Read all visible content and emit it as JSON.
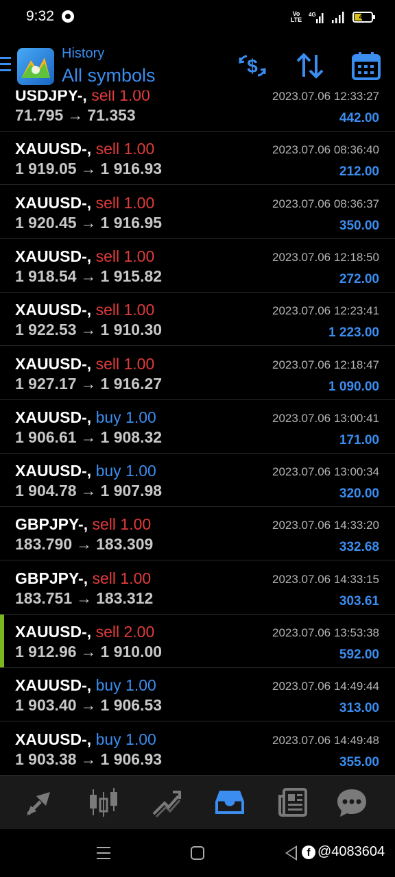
{
  "status_bar": {
    "time": "9:32",
    "network": "4G",
    "volte_line1": "Vo",
    "volte_line2": "LTE",
    "battery": "43"
  },
  "header": {
    "subtitle": "History",
    "title": "All symbols"
  },
  "trades": [
    {
      "symbol": "USDJPY-,",
      "side": "sell",
      "volume": "1.00",
      "open": "71.795",
      "close": "71.353",
      "time": "2023.07.06 12:33:27",
      "profit": "442.00"
    },
    {
      "symbol": "XAUUSD-,",
      "side": "sell",
      "volume": "1.00",
      "open": "1 919.05",
      "close": "1 916.93",
      "time": "2023.07.06 08:36:40",
      "profit": "212.00"
    },
    {
      "symbol": "XAUUSD-,",
      "side": "sell",
      "volume": "1.00",
      "open": "1 920.45",
      "close": "1 916.95",
      "time": "2023.07.06 08:36:37",
      "profit": "350.00"
    },
    {
      "symbol": "XAUUSD-,",
      "side": "sell",
      "volume": "1.00",
      "open": "1 918.54",
      "close": "1 915.82",
      "time": "2023.07.06 12:18:50",
      "profit": "272.00"
    },
    {
      "symbol": "XAUUSD-,",
      "side": "sell",
      "volume": "1.00",
      "open": "1 922.53",
      "close": "1 910.30",
      "time": "2023.07.06 12:23:41",
      "profit": "1 223.00"
    },
    {
      "symbol": "XAUUSD-,",
      "side": "sell",
      "volume": "1.00",
      "open": "1 927.17",
      "close": "1 916.27",
      "time": "2023.07.06 12:18:47",
      "profit": "1 090.00"
    },
    {
      "symbol": "XAUUSD-,",
      "side": "buy",
      "volume": "1.00",
      "open": "1 906.61",
      "close": "1 908.32",
      "time": "2023.07.06 13:00:41",
      "profit": "171.00"
    },
    {
      "symbol": "XAUUSD-,",
      "side": "buy",
      "volume": "1.00",
      "open": "1 904.78",
      "close": "1 907.98",
      "time": "2023.07.06 13:00:34",
      "profit": "320.00"
    },
    {
      "symbol": "GBPJPY-,",
      "side": "sell",
      "volume": "1.00",
      "open": "183.790",
      "close": "183.309",
      "time": "2023.07.06 14:33:20",
      "profit": "332.68"
    },
    {
      "symbol": "GBPJPY-,",
      "side": "sell",
      "volume": "1.00",
      "open": "183.751",
      "close": "183.312",
      "time": "2023.07.06 14:33:15",
      "profit": "303.61"
    },
    {
      "symbol": "XAUUSD-,",
      "side": "sell",
      "volume": "2.00",
      "open": "1 912.96",
      "close": "1 910.00",
      "time": "2023.07.06 13:53:38",
      "profit": "592.00",
      "highlighted": true
    },
    {
      "symbol": "XAUUSD-,",
      "side": "buy",
      "volume": "1.00",
      "open": "1 903.40",
      "close": "1 906.53",
      "time": "2023.07.06 14:49:44",
      "profit": "313.00"
    },
    {
      "symbol": "XAUUSD-,",
      "side": "buy",
      "volume": "1.00",
      "open": "1 903.38",
      "close": "1 906.93",
      "time": "2023.07.06 14:49:48",
      "profit": "355.00"
    }
  ],
  "arrow_glyph": "→",
  "bottom_nav": [
    {
      "name": "quotes",
      "icon": "quotes-icon"
    },
    {
      "name": "chart",
      "icon": "candlestick-icon"
    },
    {
      "name": "trade",
      "icon": "trade-icon"
    },
    {
      "name": "history",
      "icon": "inbox-icon",
      "active": true
    },
    {
      "name": "news",
      "icon": "news-icon"
    },
    {
      "name": "chat",
      "icon": "chat-icon"
    }
  ],
  "watermark": "@4083604",
  "colors": {
    "accent": "#3b8df0",
    "sell": "#e33b3b",
    "buy": "#3b8df0",
    "highlight_bar": "#7ab81f",
    "background": "#000000",
    "nav_background": "#1a1a1a"
  }
}
